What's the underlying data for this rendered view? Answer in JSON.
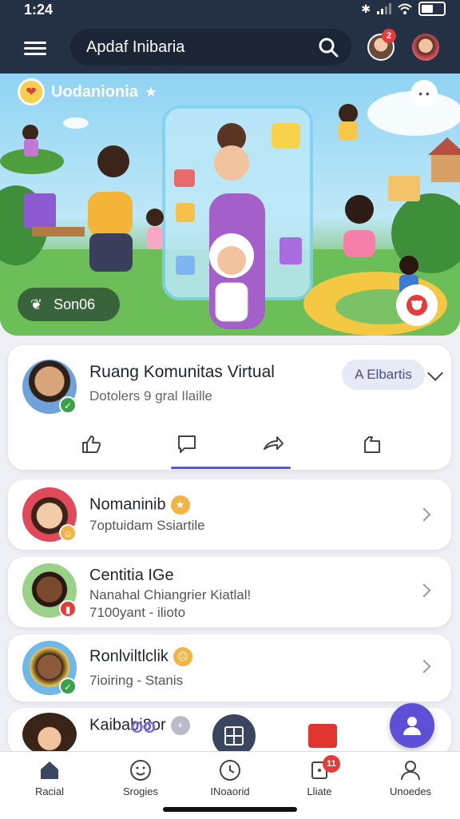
{
  "status": {
    "time": "1:24"
  },
  "search": {
    "text": "Apdaf Inibaria",
    "notif_count": "2"
  },
  "hero": {
    "title": "Uodanionia",
    "chip_label": "Son06"
  },
  "post": {
    "title": "Ruang Komunitas Virtual",
    "subtitle": "Dotolers 9 gral Ilaille",
    "follow_label": "A Elbartis"
  },
  "list": [
    {
      "title": "Nomaninib",
      "subtitle": "7optuidam Ssiartile",
      "line2": ""
    },
    {
      "title": "Centitia IGe",
      "subtitle": "Nanahal Chiangrier Kiatlal!",
      "line2": "7100yant - ilioto"
    },
    {
      "title": "Ronlviltlclik",
      "subtitle": "7ioiring - Stanis",
      "line2": ""
    },
    {
      "title": "Kaibabi8or",
      "subtitle": "",
      "line2": ""
    }
  ],
  "nav": [
    {
      "label": "Racial",
      "icon": "home-icon"
    },
    {
      "label": "Srogies",
      "icon": "smile-icon"
    },
    {
      "label": "INoaorid",
      "icon": "clock-icon"
    },
    {
      "label": "Lliate",
      "icon": "bell-icon",
      "badge": "11"
    },
    {
      "label": "Unoedes",
      "icon": "user-icon"
    }
  ],
  "colors": {
    "topbar": "#243044",
    "accent": "#5a57c9",
    "fab": "#5d4fd6",
    "check": "#3aa34a"
  }
}
